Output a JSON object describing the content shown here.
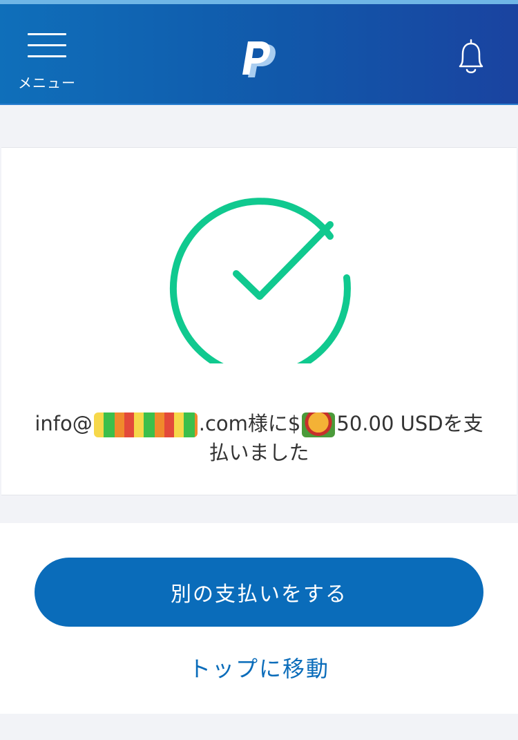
{
  "header": {
    "menu_label": "メニュー",
    "logo_icon": "paypal-logo",
    "notification_icon": "bell-icon",
    "background_colors": [
      "#0f6fba",
      "#1a43a0"
    ]
  },
  "confirmation": {
    "status_icon": "checkmark-circle-icon",
    "accent_color": "#10c98f",
    "message_prefix": "info@",
    "message_middle": ".com様に$",
    "message_amount": "50.00 USD",
    "message_suffix": "を支払いました"
  },
  "actions": {
    "primary_label": "別の支払いをする",
    "secondary_label": "トップに移動",
    "primary_color": "#0a6cba"
  }
}
